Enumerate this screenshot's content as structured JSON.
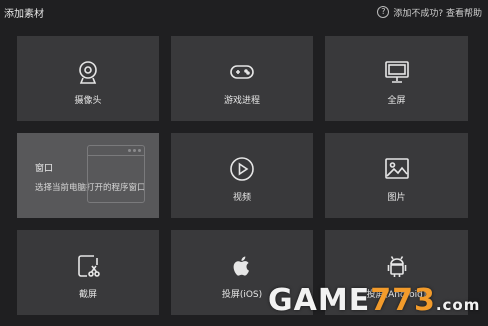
{
  "window": {
    "title": "添加素材",
    "help_link": "添加不成功? 查看帮助"
  },
  "tiles": [
    {
      "label": "摄像头",
      "icon": "webcam-icon"
    },
    {
      "label": "游戏进程",
      "icon": "gamepad-icon"
    },
    {
      "label": "全屏",
      "icon": "monitor-icon"
    },
    {
      "label": "窗口",
      "icon": "window-icon",
      "description": "选择当前电脑打开的程序窗口",
      "selected": true
    },
    {
      "label": "视频",
      "icon": "play-circle-icon"
    },
    {
      "label": "图片",
      "icon": "image-icon"
    },
    {
      "label": "截屏",
      "icon": "screenshot-crop-icon"
    },
    {
      "label": "投屏(iOS)",
      "icon": "apple-icon"
    },
    {
      "label": "投屏(Android)",
      "icon": "android-icon"
    }
  ],
  "watermark": {
    "prefix": "GAME",
    "number": "773",
    "suffix": ".com"
  }
}
